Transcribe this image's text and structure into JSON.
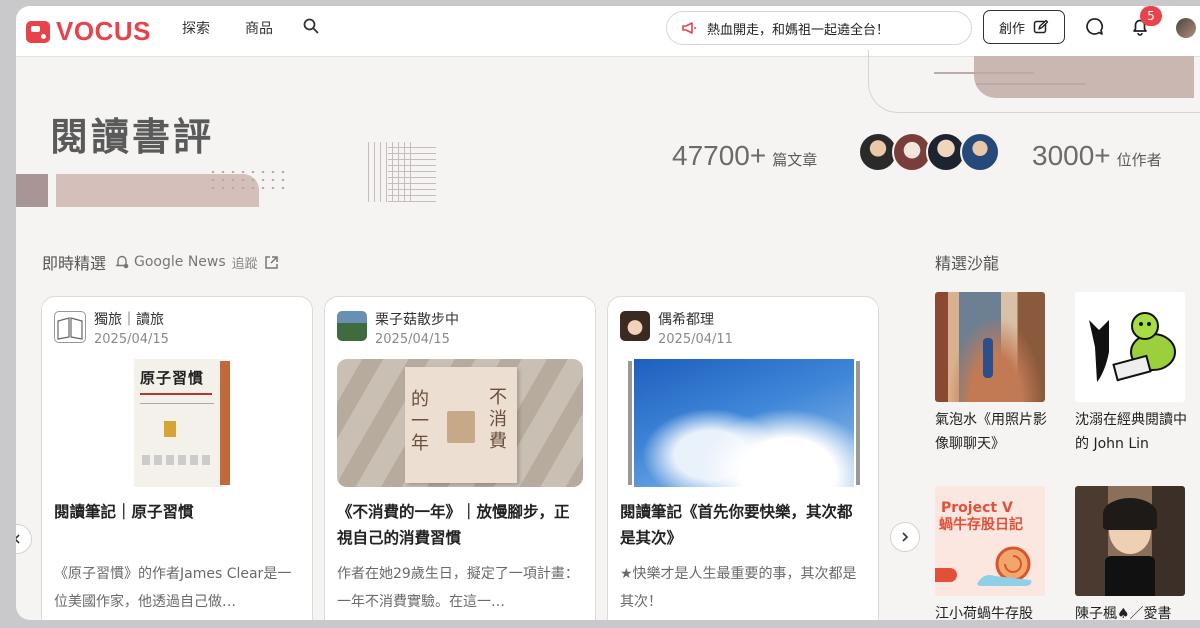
{
  "header": {
    "logo_text": "VOCUS",
    "nav": [
      "探索",
      "商品"
    ],
    "announcement": "熱血開走，和媽祖一起遶全台！",
    "create_label": "創作",
    "notification_count": "5"
  },
  "hero": {
    "title": "閱讀書評",
    "articles_count": "47700+",
    "articles_unit": "篇文章",
    "authors_count": "3000+",
    "authors_unit": "位作者"
  },
  "featured": {
    "title": "即時精選",
    "google_news": "Google News",
    "follow": "追蹤",
    "cards": [
      {
        "author": "獨旅｜讀旅",
        "date": "2025/04/15",
        "title": "閱讀筆記｜原子習慣",
        "excerpt": "《原子習慣》的作者James Clear是一位美國作家，他透過自己做…"
      },
      {
        "author": "栗子菇散步中",
        "date": "2025/04/15",
        "title": "《不消費的一年》｜放慢腳步，正視自己的消費習慣",
        "excerpt": "作者在她29歲生日，擬定了一項計畫：一年不消費實驗。在這一…"
      },
      {
        "author": "偶希都理",
        "date": "2025/04/11",
        "title": "閱讀筆記《首先你要快樂，其次都是其次》",
        "excerpt": "★快樂才是人生最重要的事，其次都是其次！"
      }
    ]
  },
  "salons": {
    "title": "精選沙龍",
    "items": [
      {
        "name": "氣泡水《用照片影像聊聊天》"
      },
      {
        "name": "沈溺在經典閱讀中的 John Lin"
      },
      {
        "name": "江小荷蝸牛存股"
      },
      {
        "name": "陳子楓♠／愛書"
      }
    ]
  },
  "book_covers": {
    "atomic_habits": "原子習慣",
    "no_spend_left": "的一年",
    "no_spend_right": "不消費"
  },
  "colors": {
    "brand": "#e8424a",
    "hero_accent": "#cbb7b2"
  }
}
